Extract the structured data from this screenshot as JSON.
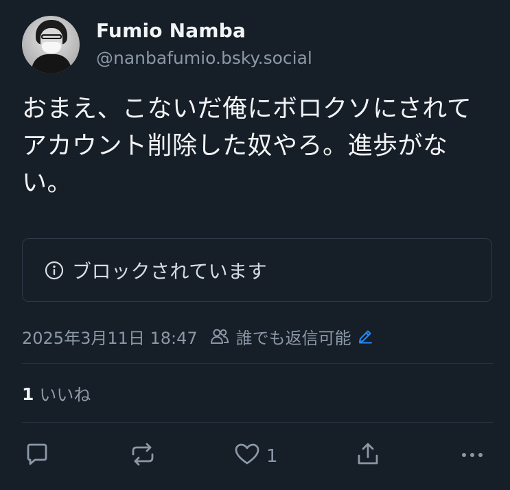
{
  "author": {
    "display_name": "Fumio Namba",
    "handle": "@nanbafumio.bsky.social"
  },
  "post": {
    "text": "おまえ、こないだ俺にボロクソにされてアカウント削除した奴やろ。進歩がない。"
  },
  "blocked_card": {
    "icon": "info-circle-icon",
    "text": "ブロックされています"
  },
  "meta": {
    "timestamp": "2025年3月11日 18:47",
    "reply_setting": "誰でも返信可能"
  },
  "likes": {
    "count": "1",
    "label": "いいね"
  },
  "actions": {
    "like_count": "1"
  },
  "colors": {
    "background": "#161e27",
    "text_primary": "#f1f3f5",
    "text_secondary": "#8b98a8",
    "border": "#2e3a48",
    "accent": "#208bfe"
  }
}
